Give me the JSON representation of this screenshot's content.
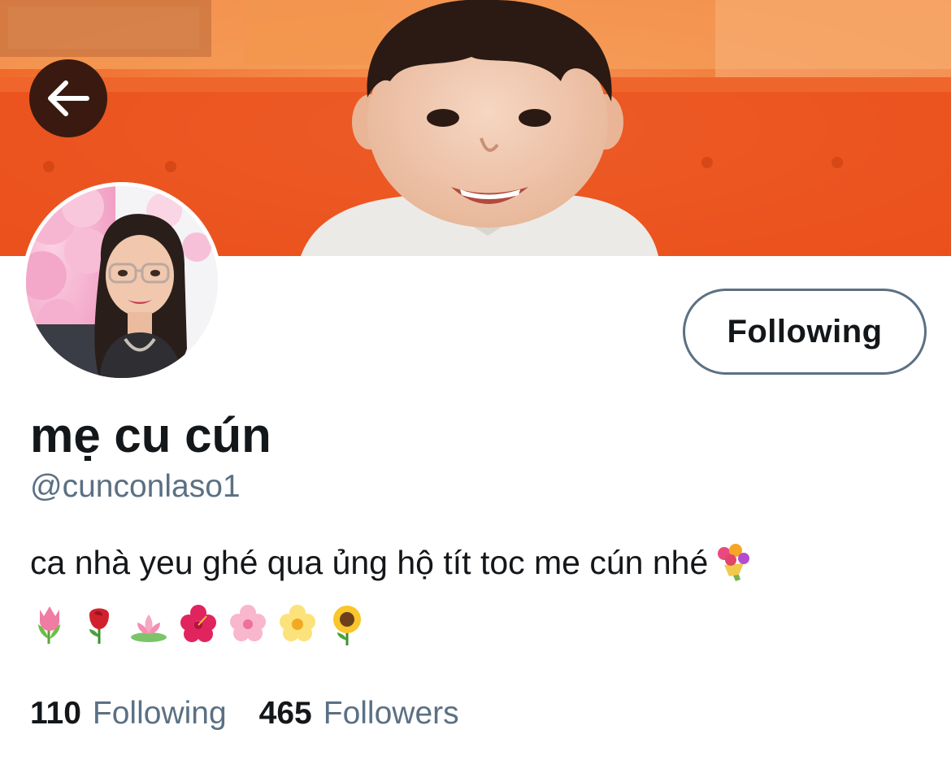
{
  "banner": {
    "description_icon": "banner-photo"
  },
  "navigation": {
    "back_icon": "arrow-left-icon"
  },
  "profile": {
    "display_name": "mẹ cu cún",
    "handle": "@cunconlaso1",
    "bio": "ca nhà yeu ghé qua ủng hộ tít toc me cún nhé",
    "bio_trailing_emoji": "bouquet",
    "emoji_row": [
      "tulip",
      "rose",
      "lotus",
      "hibiscus",
      "cherry-blossom",
      "blossom",
      "sunflower"
    ],
    "follow_button_label": "Following"
  },
  "stats": {
    "following_count": "110",
    "following_label": "Following",
    "followers_count": "465",
    "followers_label": "Followers"
  },
  "colors": {
    "text_primary": "#14171a",
    "text_secondary": "#5b7083",
    "button_border": "#5b7083",
    "banner_orange": "#f36f2a"
  }
}
